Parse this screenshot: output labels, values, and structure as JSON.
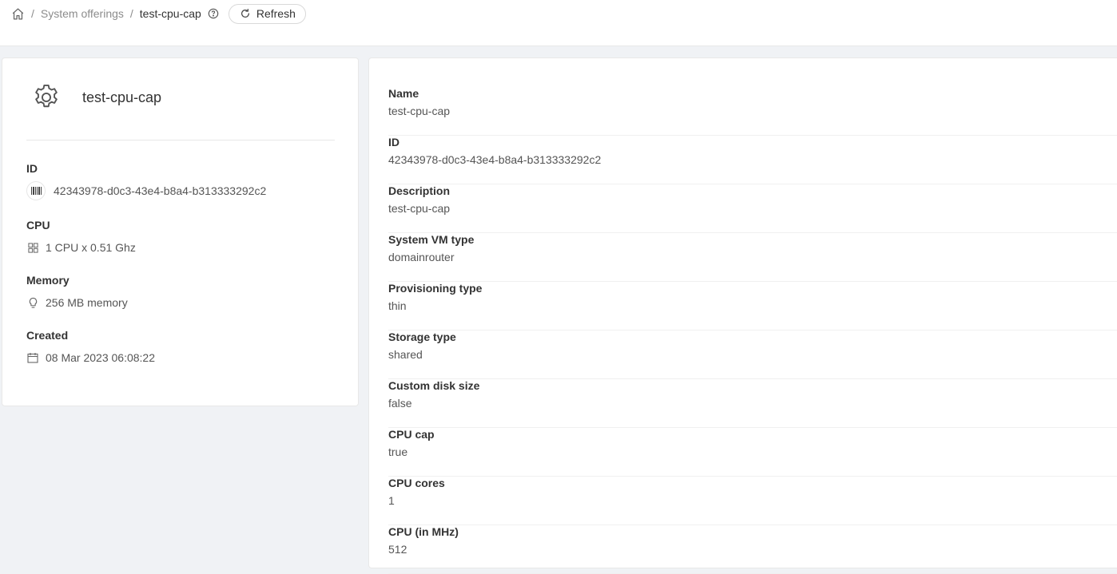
{
  "breadcrumb": {
    "home_icon": "home-icon",
    "parent": "System offerings",
    "current": "test-cpu-cap",
    "separator": "/",
    "help_icon": "question-circle-icon"
  },
  "toolbar": {
    "refresh_label": "Refresh",
    "refresh_icon": "reload-icon"
  },
  "resource": {
    "icon": "gear-icon",
    "name": "test-cpu-cap",
    "fields": [
      {
        "label": "ID",
        "icon": "barcode-icon",
        "value": "42343978-d0c3-43e4-b8a4-b313333292c2"
      },
      {
        "label": "CPU",
        "icon": "appstore-icon",
        "value": "1 CPU x 0.51 Ghz"
      },
      {
        "label": "Memory",
        "icon": "bulb-icon",
        "value": "256 MB memory"
      },
      {
        "label": "Created",
        "icon": "calendar-icon",
        "value": "08 Mar 2023 06:08:22"
      }
    ]
  },
  "details": [
    {
      "label": "Name",
      "value": "test-cpu-cap"
    },
    {
      "label": "ID",
      "value": "42343978-d0c3-43e4-b8a4-b313333292c2"
    },
    {
      "label": "Description",
      "value": "test-cpu-cap"
    },
    {
      "label": "System VM type",
      "value": "domainrouter"
    },
    {
      "label": "Provisioning type",
      "value": "thin"
    },
    {
      "label": "Storage type",
      "value": "shared"
    },
    {
      "label": "Custom disk size",
      "value": "false"
    },
    {
      "label": "CPU cap",
      "value": "true"
    },
    {
      "label": "CPU cores",
      "value": "1"
    },
    {
      "label": "CPU (in MHz)",
      "value": "512"
    }
  ]
}
